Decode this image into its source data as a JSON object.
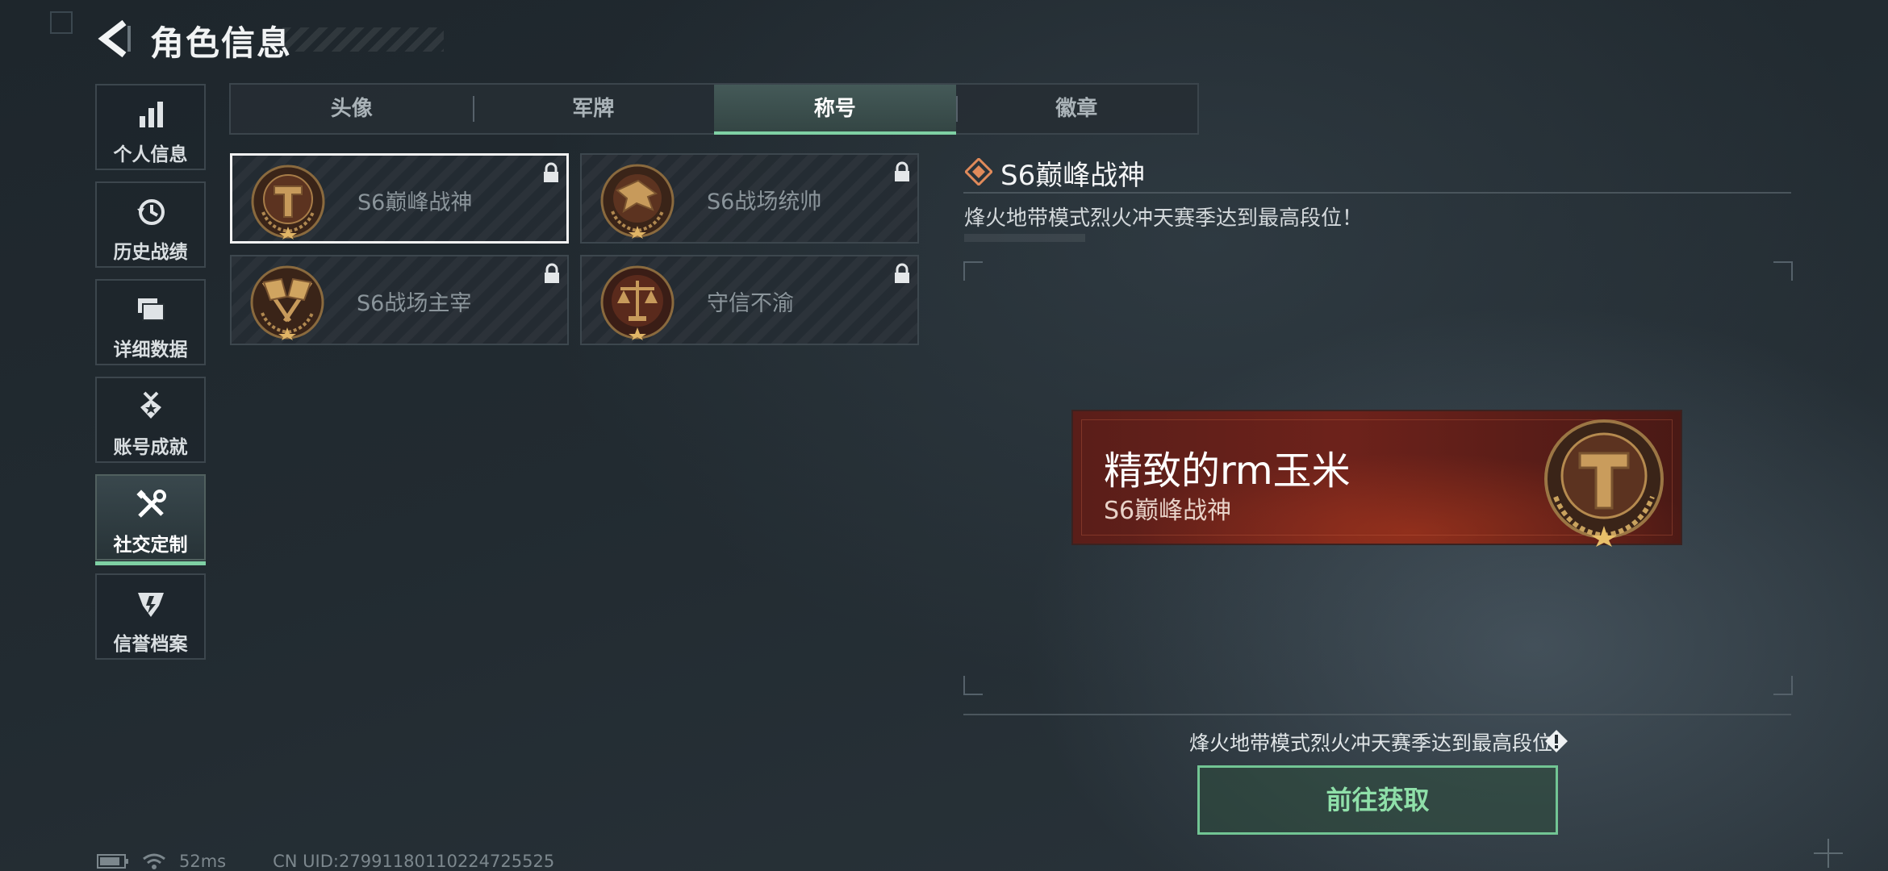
{
  "header": {
    "title": "角色信息",
    "back_icon": "back-arrow-icon"
  },
  "nav": {
    "items": [
      {
        "label": "个人信息",
        "icon": "bar-chart-icon",
        "active": false
      },
      {
        "label": "历史战绩",
        "icon": "history-clock-icon",
        "active": false
      },
      {
        "label": "详细数据",
        "icon": "folder-stack-icon",
        "active": false
      },
      {
        "label": "账号成就",
        "icon": "achievement-medal-icon",
        "active": false
      },
      {
        "label": "社交定制",
        "icon": "tools-icon",
        "active": true
      },
      {
        "label": "信誉档案",
        "icon": "credit-emblem-icon",
        "active": false
      }
    ]
  },
  "tabs": [
    {
      "label": "头像",
      "active": false
    },
    {
      "label": "军牌",
      "active": false
    },
    {
      "label": "称号",
      "active": true
    },
    {
      "label": "徽章",
      "active": false
    }
  ],
  "titles": [
    {
      "name": "S6巅峰战神",
      "medal": "shield-t-medal-icon",
      "locked": true,
      "selected": true
    },
    {
      "name": "S6战场统帅",
      "medal": "eagle-medal-icon",
      "locked": true,
      "selected": false
    },
    {
      "name": "S6战场主宰",
      "medal": "crossed-flags-medal-icon",
      "locked": true,
      "selected": false
    },
    {
      "name": "守信不渝",
      "medal": "scales-medal-icon",
      "locked": true,
      "selected": false
    }
  ],
  "detail": {
    "title": "S6巅峰战神",
    "description": "烽火地带模式烈火冲天赛季达到最高段位！",
    "preview": {
      "player_name": "精致的rm玉米",
      "title": "S6巅峰战神"
    },
    "acquire_hint": "烽火地带模式烈火冲天赛季达到最高段位",
    "acquire_button": "前往获取"
  },
  "status": {
    "battery_icon": "battery-icon",
    "wifi_icon": "wifi-icon",
    "ping": "52ms",
    "uid": "CN UID:27991180110224725525"
  },
  "colors": {
    "accent_green": "#7fd0a4",
    "button_green": "#72c594",
    "medal_bronze": "#b08850",
    "plate_red": "#6d221b"
  }
}
